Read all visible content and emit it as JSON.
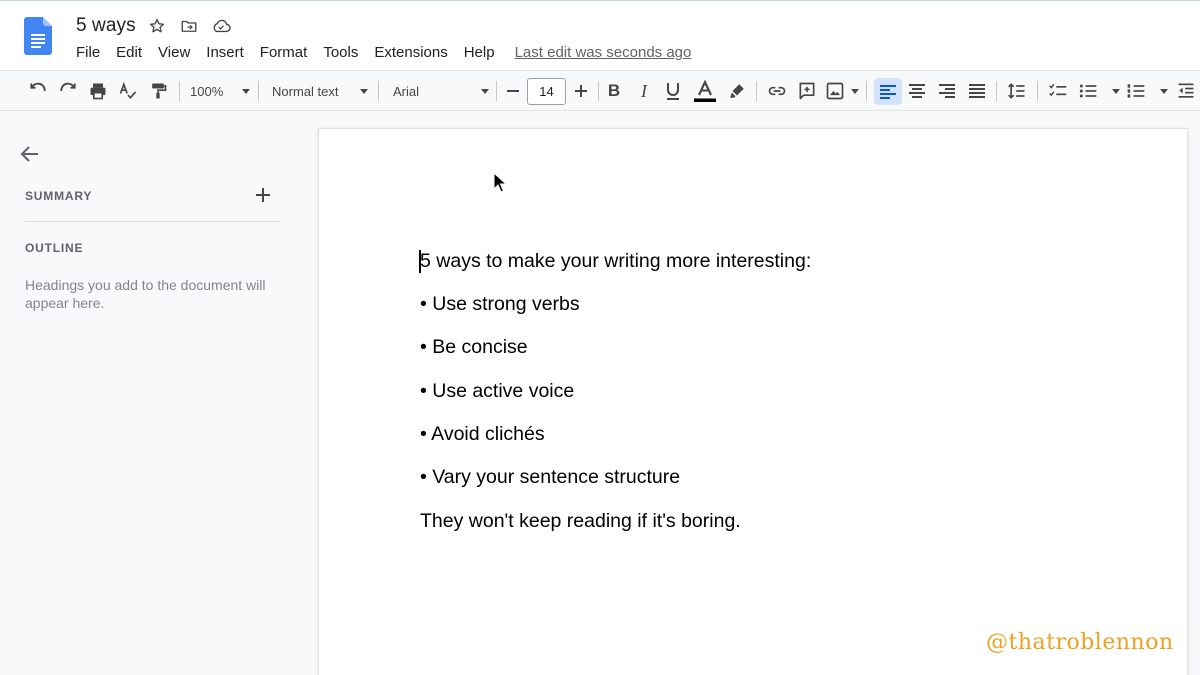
{
  "header": {
    "title": "5 ways",
    "menu": [
      "File",
      "Edit",
      "View",
      "Insert",
      "Format",
      "Tools",
      "Extensions",
      "Help"
    ],
    "last_edit": "Last edit was seconds ago",
    "icons": [
      "docs-logo-icon",
      "star-icon",
      "move-folder-icon",
      "cloud-status-icon"
    ]
  },
  "toolbar": {
    "zoom": "100%",
    "style": "Normal text",
    "font": "Arial",
    "font_size": "14",
    "text_color": "#000000",
    "icons": [
      "undo-icon",
      "redo-icon",
      "print-icon",
      "spellcheck-icon",
      "paint-format-icon",
      "decrease-font-icon",
      "increase-font-icon",
      "bold-icon",
      "italic-icon",
      "underline-icon",
      "text-color-icon",
      "highlight-icon",
      "link-icon",
      "comment-icon",
      "image-icon",
      "align-left-icon",
      "align-center-icon",
      "align-right-icon",
      "justify-icon",
      "line-spacing-icon",
      "checklist-icon",
      "bulleted-list-icon",
      "numbered-list-icon",
      "decrease-indent-icon"
    ]
  },
  "sidebar": {
    "summary_label": "SUMMARY",
    "outline_label": "OUTLINE",
    "outline_hint": "Headings you add to the document will appear here."
  },
  "document": {
    "lines": [
      "5 ways to make your writing more interesting:",
      "• Use strong verbs",
      "• Be concise",
      "• Use active voice",
      "• Avoid clichés",
      "• Vary your sentence structure",
      "They won't keep reading if it's boring."
    ]
  },
  "watermark": "@thatroblennon",
  "colors": {
    "accent": "#1a73e8",
    "active_bg": "#d3e3fd",
    "watermark": "#f0a020"
  }
}
